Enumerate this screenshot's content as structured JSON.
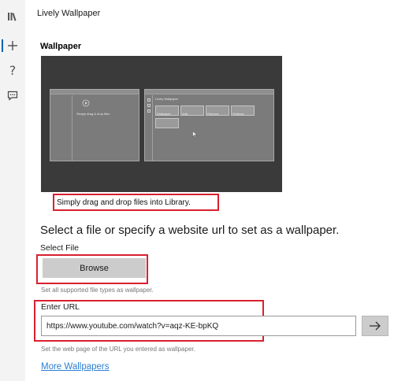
{
  "window": {
    "title": "Lively Wallpaper"
  },
  "sidebar": {
    "items": [
      {
        "icon": "library-icon"
      },
      {
        "icon": "add-icon",
        "active": true
      },
      {
        "icon": "help-icon",
        "glyph": "?"
      },
      {
        "icon": "feedback-icon"
      }
    ]
  },
  "section": {
    "title": "Wallpaper"
  },
  "preview": {
    "left_window_caption": "Simply drag & drop files",
    "right_window_title": "Lively Wallpaper",
    "right_window_items": [
      "Wallpaper",
      "Add",
      "Remove",
      "Settings"
    ]
  },
  "caption": "Simply drag and drop files into Library.",
  "headline": "Select a file or specify a website url to set as a wallpaper.",
  "select_file": {
    "label": "Select File",
    "button": "Browse",
    "hint": "Set all supported file types as wallpaper."
  },
  "enter_url": {
    "label": "Enter URL",
    "value": "https://www.youtube.com/watch?v=aqz-KE-bpKQ",
    "hint": "Set the web page of the URL you entered as wallpaper.",
    "go_icon": "arrow-right-icon"
  },
  "more_link": "More Wallpapers",
  "colors": {
    "accent": "#0063b1",
    "highlight": "#d9202f",
    "link": "#2a7fd4",
    "preview_bg": "#3a3a3a",
    "button_bg": "#cccccc"
  }
}
